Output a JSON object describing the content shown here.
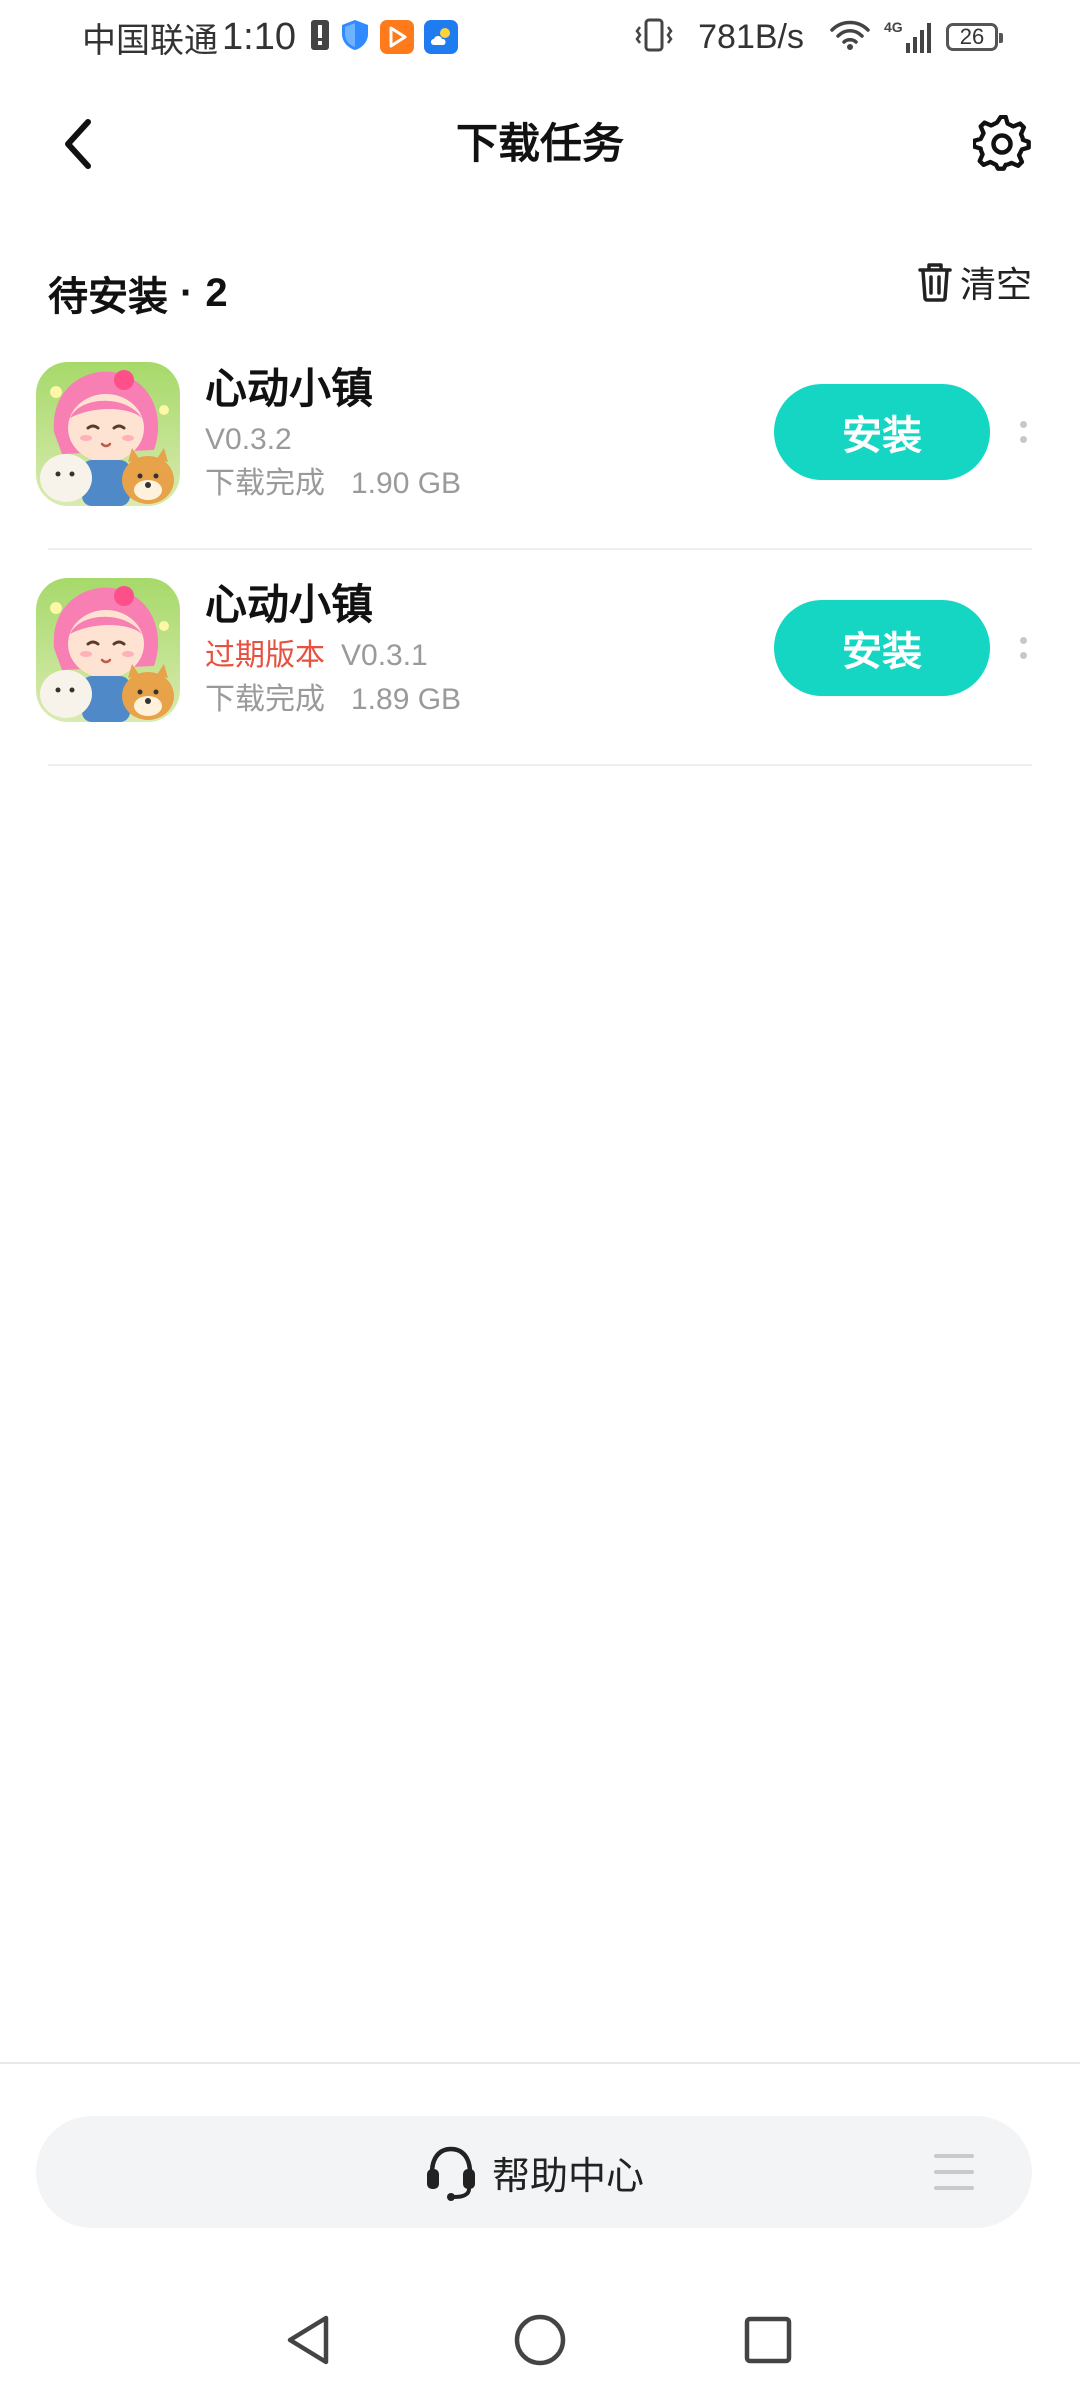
{
  "status_bar": {
    "carrier": "中国联通",
    "time": "1:10",
    "net_speed": "781B/s",
    "network_type": "4G",
    "battery": "26",
    "notification_icons": [
      "alert-icon",
      "shield-icon",
      "video-app-icon",
      "weather-app-icon"
    ]
  },
  "header": {
    "title": "下载任务"
  },
  "section": {
    "title": "待安装",
    "separator": "·",
    "count": "2",
    "clear_label": "清空"
  },
  "apps": [
    {
      "name": "心动小镇",
      "expired_label": "",
      "version": "V0.3.2",
      "status": "下载完成",
      "size": "1.90 GB",
      "install_label": "安装"
    },
    {
      "name": "心动小镇",
      "expired_label": "过期版本",
      "version": "V0.3.1",
      "status": "下载完成",
      "size": "1.89 GB",
      "install_label": "安装"
    }
  ],
  "footer": {
    "help_label": "帮助中心"
  },
  "colors": {
    "accent": "#14d6c3",
    "expired": "#e5523f",
    "secondary_text": "#9a9a9a"
  }
}
